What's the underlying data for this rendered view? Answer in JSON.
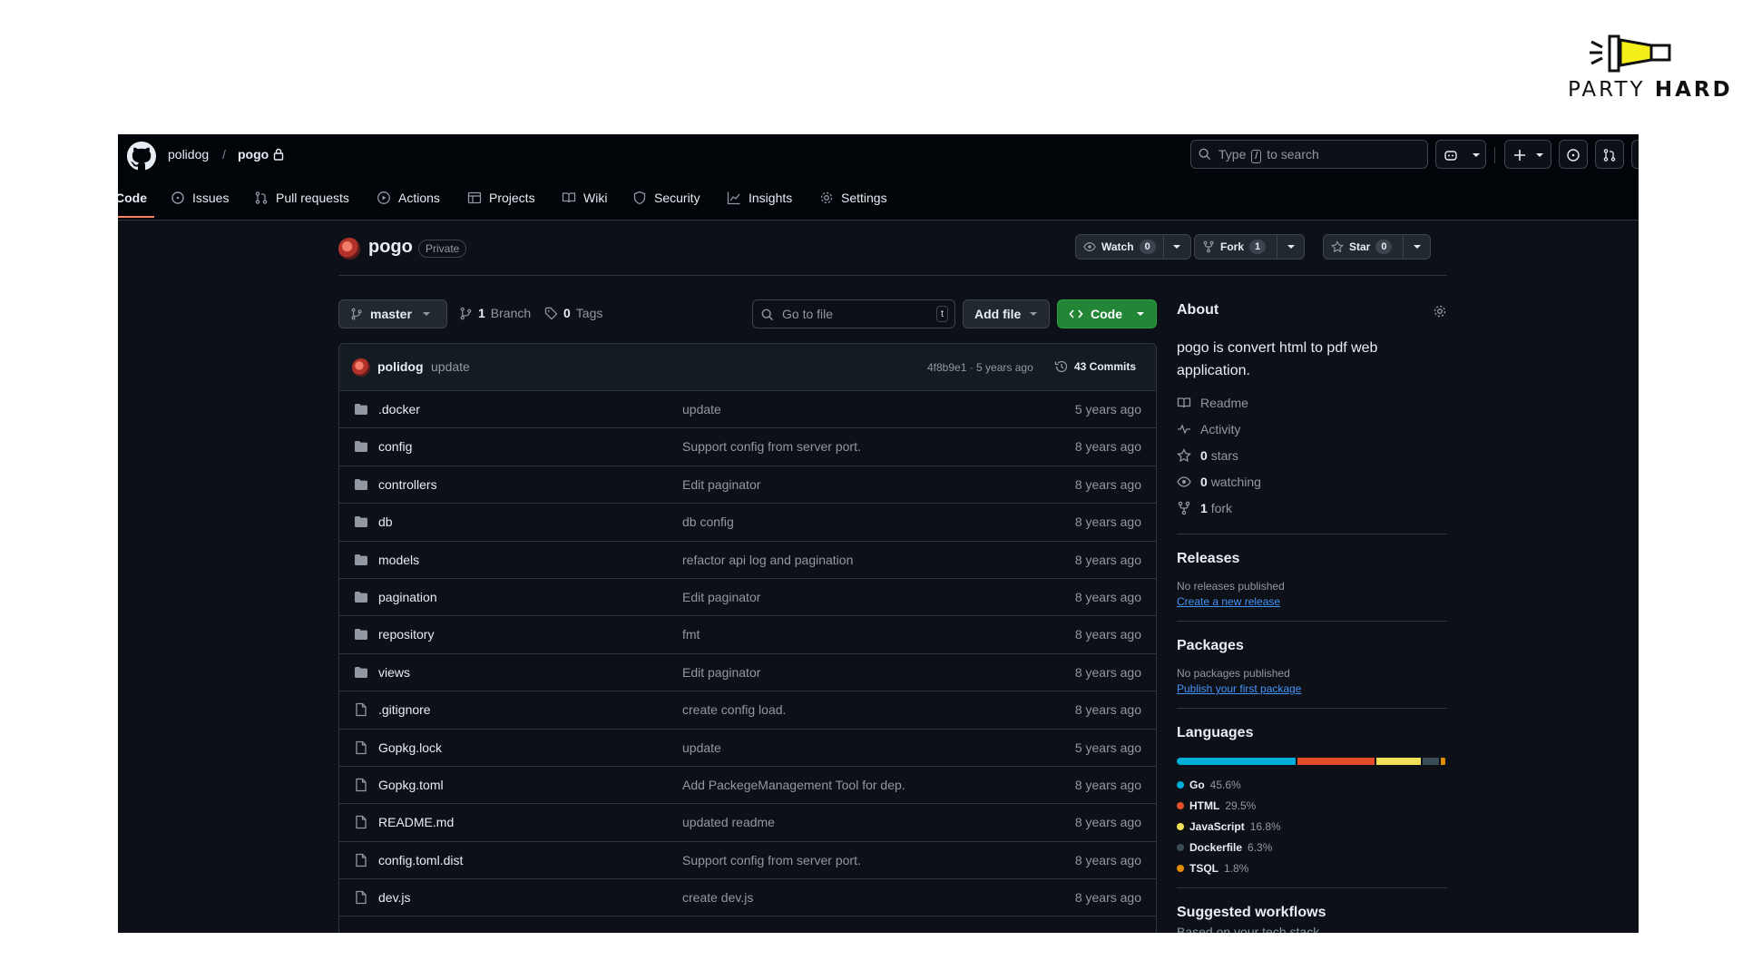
{
  "logo": {
    "text_light": "PARTY ",
    "text_bold": "HARD"
  },
  "header": {
    "owner": "polidog",
    "separator": "/",
    "repo": "pogo",
    "search": {
      "prefix": "Type",
      "key": "/",
      "suffix": "to search"
    }
  },
  "tabs": [
    {
      "label": "Code",
      "icon": "code-icon"
    },
    {
      "label": "Issues",
      "icon": "issue-icon"
    },
    {
      "label": "Pull requests",
      "icon": "pull-request-icon"
    },
    {
      "label": "Actions",
      "icon": "play-icon"
    },
    {
      "label": "Projects",
      "icon": "table-icon"
    },
    {
      "label": "Wiki",
      "icon": "book-icon"
    },
    {
      "label": "Security",
      "icon": "shield-icon"
    },
    {
      "label": "Insights",
      "icon": "graph-icon"
    },
    {
      "label": "Settings",
      "icon": "gear-icon"
    }
  ],
  "repo": {
    "name": "pogo",
    "visibility": "Private",
    "watch": {
      "label": "Watch",
      "count": "0"
    },
    "fork": {
      "label": "Fork",
      "count": "1"
    },
    "star": {
      "label": "Star",
      "count": "0"
    }
  },
  "branch_bar": {
    "branch": "master",
    "branches": {
      "count": "1",
      "label": "Branch"
    },
    "tags": {
      "count": "0",
      "label": "Tags"
    },
    "goto_placeholder": "Go to file",
    "goto_key": "t",
    "add_file": "Add file",
    "code": "Code"
  },
  "latest_commit": {
    "author": "polidog",
    "message": "update",
    "sha_age": "4f8b9e1 · 5 years ago",
    "commits": "43 Commits"
  },
  "files": [
    {
      "type": "folder",
      "name": ".docker",
      "message": "update",
      "age": "5 years ago"
    },
    {
      "type": "folder",
      "name": "config",
      "message": "Support config from server port.",
      "age": "8 years ago"
    },
    {
      "type": "folder",
      "name": "controllers",
      "message": "Edit paginator",
      "age": "8 years ago"
    },
    {
      "type": "folder",
      "name": "db",
      "message": "db config",
      "age": "8 years ago"
    },
    {
      "type": "folder",
      "name": "models",
      "message": "refactor api log and pagination",
      "age": "8 years ago"
    },
    {
      "type": "folder",
      "name": "pagination",
      "message": "Edit paginator",
      "age": "8 years ago"
    },
    {
      "type": "folder",
      "name": "repository",
      "message": "fmt",
      "age": "8 years ago"
    },
    {
      "type": "folder",
      "name": "views",
      "message": "Edit paginator",
      "age": "8 years ago"
    },
    {
      "type": "file",
      "name": ".gitignore",
      "message": "create config load.",
      "age": "8 years ago"
    },
    {
      "type": "file",
      "name": "Gopkg.lock",
      "message": "update",
      "age": "5 years ago"
    },
    {
      "type": "file",
      "name": "Gopkg.toml",
      "message": "Add PackegeManagement Tool for dep.",
      "age": "8 years ago"
    },
    {
      "type": "file",
      "name": "README.md",
      "message": "updated readme",
      "age": "8 years ago"
    },
    {
      "type": "file",
      "name": "config.toml.dist",
      "message": "Support config from server port.",
      "age": "8 years ago"
    },
    {
      "type": "file",
      "name": "dev.js",
      "message": "create dev.js",
      "age": "8 years ago"
    }
  ],
  "about": {
    "title": "About",
    "description": "pogo is convert html to pdf web application.",
    "links": [
      {
        "icon": "book-icon",
        "bold": "",
        "text": "Readme"
      },
      {
        "icon": "pulse-icon",
        "bold": "",
        "text": "Activity"
      },
      {
        "icon": "star-icon",
        "bold": "0",
        "text": "stars"
      },
      {
        "icon": "eye-icon",
        "bold": "0",
        "text": "watching"
      },
      {
        "icon": "fork-icon",
        "bold": "1",
        "text": "fork"
      }
    ]
  },
  "releases": {
    "title": "Releases",
    "empty": "No releases published",
    "link": "Create a new release"
  },
  "packages": {
    "title": "Packages",
    "empty": "No packages published",
    "link": "Publish your first package"
  },
  "languages": {
    "title": "Languages",
    "items": [
      {
        "name": "Go",
        "percent": "45.6%",
        "value": 45.6,
        "color": "#00add8"
      },
      {
        "name": "HTML",
        "percent": "29.5%",
        "value": 29.5,
        "color": "#e34c26"
      },
      {
        "name": "JavaScript",
        "percent": "16.8%",
        "value": 16.8,
        "color": "#f1e05a"
      },
      {
        "name": "Dockerfile",
        "percent": "6.3%",
        "value": 6.3,
        "color": "#384d54"
      },
      {
        "name": "TSQL",
        "percent": "1.8%",
        "value": 1.8,
        "color": "#e38c00"
      }
    ]
  },
  "workflows": {
    "title": "Suggested workflows",
    "subtitle": "Based on your tech stack"
  }
}
